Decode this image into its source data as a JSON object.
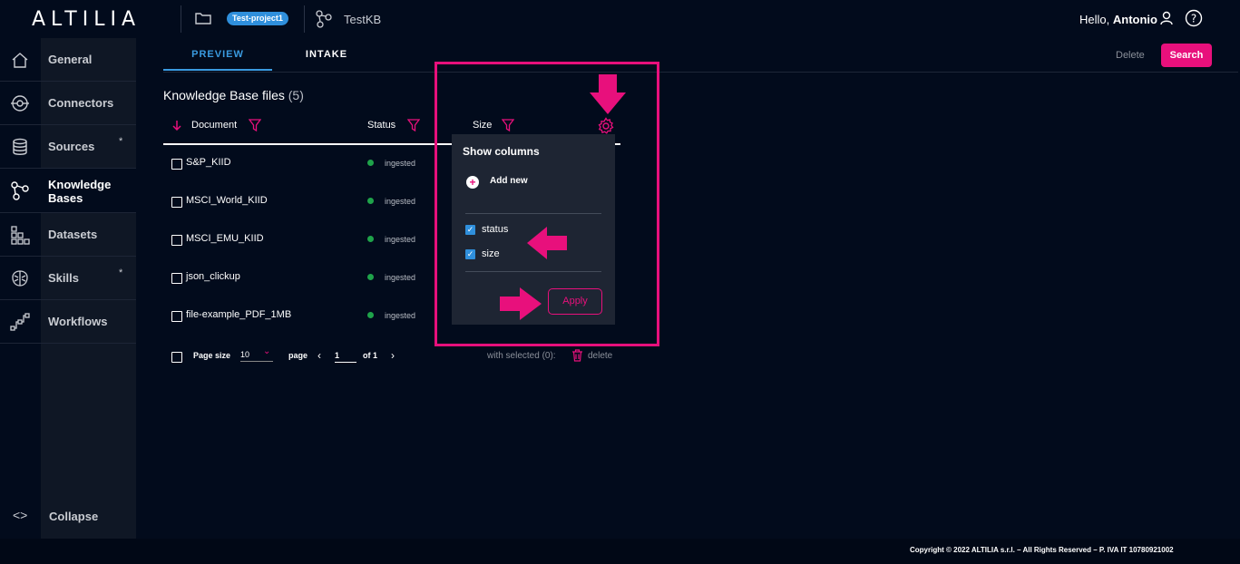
{
  "header": {
    "logo": "ALTILIA",
    "project": "Test-project1",
    "kb_name": "TestKB",
    "greeting": "Hello,",
    "user": "Antonio"
  },
  "sidebar": {
    "items": [
      {
        "label": "General",
        "icon": "home-icon"
      },
      {
        "label": "Connectors",
        "icon": "connector-icon"
      },
      {
        "label": "Sources",
        "icon": "database-icon",
        "star": "*"
      },
      {
        "label": "Knowledge Bases",
        "icon": "graph-icon",
        "active": true
      },
      {
        "label": "Datasets",
        "icon": "grid-icon"
      },
      {
        "label": "Skills",
        "icon": "brain-icon",
        "star": "*"
      },
      {
        "label": "Workflows",
        "icon": "workflow-icon"
      }
    ],
    "collapse": "Collapse",
    "collapse_icon": "<>"
  },
  "tabs": [
    "PREVIEW",
    "INTAKE"
  ],
  "actions": {
    "delete": "Delete",
    "search": "Search"
  },
  "main": {
    "title": "Knowledge Base files",
    "count": "(5)",
    "columns": [
      "Document",
      "Status",
      "Size"
    ],
    "rows": [
      {
        "name": "S&P_KIID",
        "status": "ingested"
      },
      {
        "name": "MSCI_World_KIID",
        "status": "ingested"
      },
      {
        "name": "MSCI_EMU_KIID",
        "status": "ingested"
      },
      {
        "name": "json_clickup",
        "status": "ingested"
      },
      {
        "name": "file-example_PDF_1MB",
        "status": "ingested"
      }
    ],
    "status_color": "#1fa34a"
  },
  "pager": {
    "page_size_label": "Page size",
    "page_size": "10",
    "page_label": "page",
    "page": "1",
    "of_label": "of",
    "total_pages": "1",
    "with_selected": "with selected (0):",
    "delete": "delete"
  },
  "popup": {
    "title": "Show columns",
    "add_new": "Add new",
    "options": [
      {
        "label": "status",
        "checked": true
      },
      {
        "label": "size",
        "checked": true
      }
    ],
    "apply": "Apply"
  },
  "footer": {
    "copyright": "Copyright © 2022 ALTILIA s.r.l. – All Rights Reserved – P. IVA IT 10780921002"
  },
  "colors": {
    "accent": "#e8107c",
    "primary": "#2f8fdc",
    "background": "#020b1c"
  }
}
